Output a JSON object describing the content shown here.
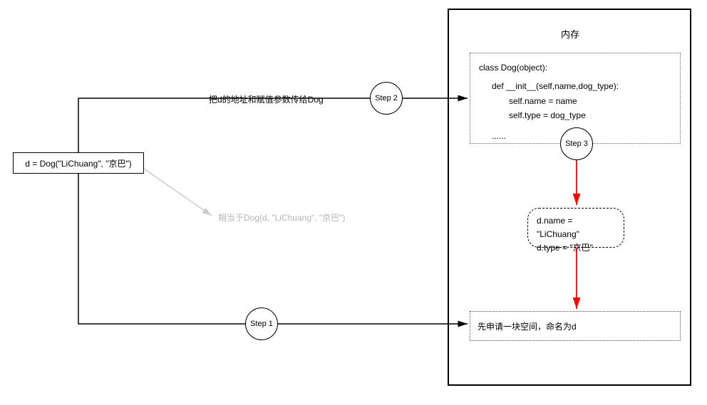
{
  "memory": {
    "title": "内存",
    "class_code": {
      "line1": "class Dog(object):",
      "line2": "def __init__(self,name,dog_type):",
      "line3": "self.name = name",
      "line4": "self.type = dog_type",
      "line5": "......"
    },
    "instance_assign": {
      "line1": "d.name = \"LiChuang\"",
      "line2": "d.type = \"京巴\""
    },
    "alloc_text": "先申请一块空间，命名为d"
  },
  "left_box": "d = Dog(\"LiChuang\", \"京巴\")",
  "labels": {
    "to_dog": "把d的地址和赋值参数传给Dog",
    "equiv": "相当于Dog(d, \"LiChuang\", \"京巴\")"
  },
  "steps": {
    "s1": "Step 1",
    "s2": "Step 2",
    "s3": "Step 3"
  },
  "colors": {
    "black": "#000000",
    "red": "#ff0000",
    "gray": "#cccccc"
  }
}
